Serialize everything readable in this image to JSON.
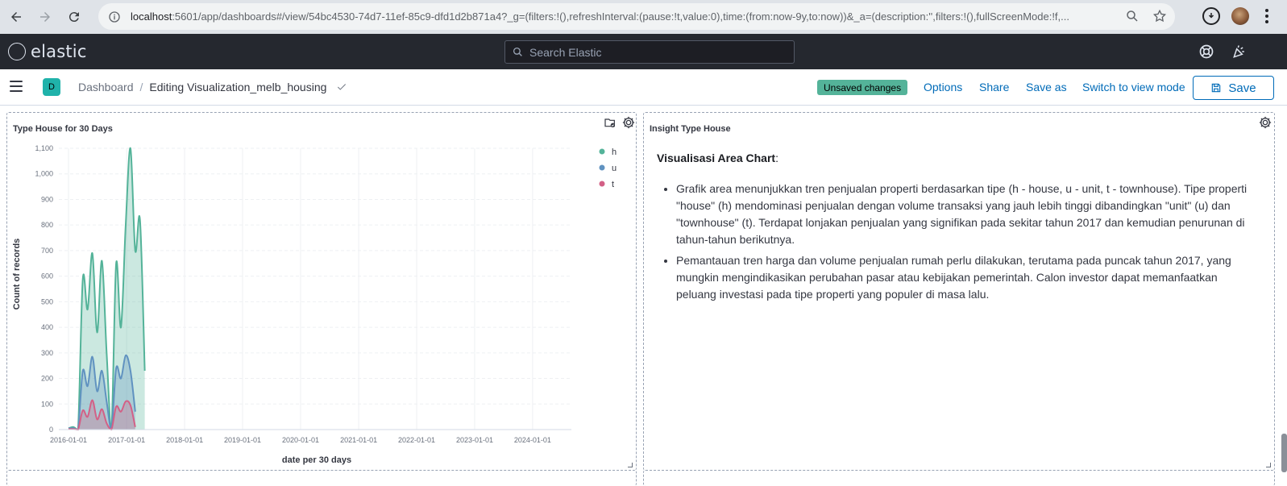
{
  "browser": {
    "url_host": "localhost",
    "url_rest": ":5601/app/dashboards#/view/54bc4530-74d7-11ef-85c9-dfd1d2b871a4?_g=(filters:!(),refreshInterval:(pause:!t,value:0),time:(from:now-9y,to:now))&_a=(description:'',filters:!(),fullScreenMode:!f,..."
  },
  "header": {
    "logo_text": "elastic",
    "search_placeholder": "Search Elastic"
  },
  "app_bar": {
    "space_initial": "D",
    "breadcrumb_root": "Dashboard",
    "breadcrumb_sep": "/",
    "breadcrumb_current": "Editing Visualization_melb_housing",
    "unsaved_badge": "Unsaved changes",
    "options_label": "Options",
    "share_label": "Share",
    "save_as_label": "Save as",
    "switch_label": "Switch to view mode",
    "save_label": "Save"
  },
  "panel_chart": {
    "title": "Type House for 30 Days"
  },
  "panel_insight": {
    "title": "Insight Type House",
    "heading": "Visualisasi Area Chart",
    "heading_suffix": ":",
    "bullets": [
      "Grafik area menunjukkan tren penjualan properti berdasarkan tipe (h - house, u - unit, t - townhouse). Tipe properti \"house\" (h) mendominasi penjualan dengan volume transaksi yang jauh lebih tinggi dibandingkan \"unit\" (u) dan \"townhouse\" (t). Terdapat lonjakan penjualan yang signifikan pada sekitar tahun 2017 dan kemudian penurunan di tahun-tahun berikutnya.",
      "Pemantauan tren harga dan volume penjualan rumah perlu dilakukan, terutama pada puncak tahun 2017, yang mungkin mengindikasikan perubahan pasar atau kebijakan pemerintah. Calon investor dapat memanfaatkan peluang investasi pada tipe properti yang populer di masa lalu."
    ]
  },
  "chart_data": {
    "type": "area",
    "title": "Type House for 30 Days",
    "xlabel": "date per 30 days",
    "ylabel": "Count of records",
    "ylim": [
      0,
      1100
    ],
    "yticks": [
      0,
      100,
      200,
      300,
      400,
      500,
      600,
      700,
      800,
      900,
      1000,
      1100
    ],
    "ytick_labels": [
      "0",
      "100",
      "200",
      "300",
      "400",
      "500",
      "600",
      "700",
      "800",
      "900",
      "1,000",
      "1,100"
    ],
    "xticks": [
      "2016-01-01",
      "2017-01-01",
      "2018-01-01",
      "2019-01-01",
      "2020-01-01",
      "2021-01-01",
      "2022-01-01",
      "2023-01-01",
      "2024-01-01"
    ],
    "xlim": [
      "2015-11-01",
      "2024-09-01"
    ],
    "grid": true,
    "legend_position": "top-right",
    "x": [
      "2016-01-01",
      "2016-01-31",
      "2016-03-01",
      "2016-03-31",
      "2016-04-30",
      "2016-05-30",
      "2016-06-29",
      "2016-07-29",
      "2016-08-28",
      "2016-09-27",
      "2016-10-27",
      "2016-11-26",
      "2016-12-26",
      "2017-01-25",
      "2017-02-24",
      "2017-03-26",
      "2017-04-25",
      "2017-05-25",
      "2017-06-24",
      "2017-07-24",
      "2017-08-23",
      "2017-09-22"
    ],
    "series": [
      {
        "name": "h",
        "color": "#54b399",
        "values": [
          5,
          10,
          0,
          590,
          470,
          690,
          380,
          660,
          300,
          0,
          650,
          400,
          800,
          1100,
          700,
          820,
          230,
          null,
          null,
          null,
          null,
          null
        ]
      },
      {
        "name": "u",
        "color": "#6092c0",
        "values": [
          5,
          5,
          0,
          230,
          170,
          285,
          150,
          230,
          110,
          0,
          240,
          200,
          290,
          230,
          70,
          null,
          null,
          null,
          null,
          null,
          null,
          null
        ]
      },
      {
        "name": "t",
        "color": "#d36086",
        "values": [
          2,
          2,
          0,
          75,
          50,
          115,
          40,
          80,
          25,
          0,
          90,
          70,
          110,
          95,
          10,
          null,
          null,
          null,
          null,
          null,
          null,
          null
        ]
      }
    ]
  }
}
